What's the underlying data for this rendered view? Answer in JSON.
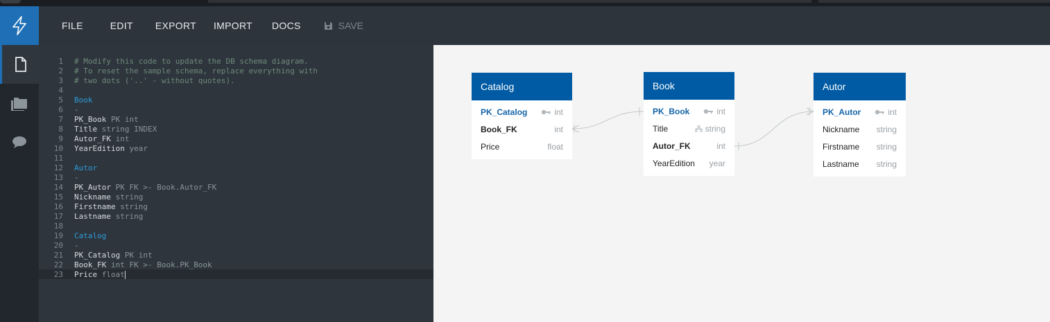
{
  "menu": {
    "file": "FILE",
    "edit": "EDIT",
    "export": "EXPORT",
    "import": "IMPORT",
    "docs": "DOCS",
    "save": "SAVE"
  },
  "sidebar": {
    "icons": [
      "bolt-logo-icon",
      "document-icon",
      "folder-icon",
      "comment-icon"
    ]
  },
  "editor": {
    "lines": [
      {
        "n": "1",
        "text": "# Modify this code to update the DB schema diagram."
      },
      {
        "n": "2",
        "text": "# To reset the sample schema, replace everything with"
      },
      {
        "n": "3",
        "text": "# two dots ('..' - without quotes)."
      },
      {
        "n": "4",
        "text": ""
      },
      {
        "n": "5",
        "text": "Book"
      },
      {
        "n": "6",
        "text": "-"
      },
      {
        "n": "7",
        "name": "PK_Book",
        "rest": " PK int"
      },
      {
        "n": "8",
        "name": "Title",
        "rest": " string INDEX"
      },
      {
        "n": "9",
        "name": "Autor_FK",
        "rest": " int"
      },
      {
        "n": "10",
        "name": "YearEdition",
        "rest": " year"
      },
      {
        "n": "11",
        "text": ""
      },
      {
        "n": "12",
        "text": "Autor"
      },
      {
        "n": "13",
        "text": "-"
      },
      {
        "n": "14",
        "name": "PK_Autor",
        "rest": " PK FK >- Book.Autor_FK"
      },
      {
        "n": "15",
        "name": "Nickname",
        "rest": " string"
      },
      {
        "n": "16",
        "name": "Firstname",
        "rest": " string"
      },
      {
        "n": "17",
        "name": "Lastname",
        "rest": " string"
      },
      {
        "n": "18",
        "text": ""
      },
      {
        "n": "19",
        "text": "Catalog"
      },
      {
        "n": "20",
        "text": "-"
      },
      {
        "n": "21",
        "name": "PK_Catalog",
        "rest": " PK int"
      },
      {
        "n": "22",
        "name": "Book_FK",
        "rest": " int FK >- Book.PK_Book"
      },
      {
        "n": "23",
        "name": "Price",
        "rest": " float"
      }
    ]
  },
  "tables": {
    "catalog": {
      "title": "Catalog",
      "fields": [
        {
          "name": "PK_Catalog",
          "type": "int"
        },
        {
          "name": "Book_FK",
          "type": "int"
        },
        {
          "name": "Price",
          "type": "float"
        }
      ]
    },
    "book": {
      "title": "Book",
      "fields": [
        {
          "name": "PK_Book",
          "type": "int"
        },
        {
          "name": "Title",
          "type": "string"
        },
        {
          "name": "Autor_FK",
          "type": "int"
        },
        {
          "name": "YearEdition",
          "type": "year"
        }
      ]
    },
    "autor": {
      "title": "Autor",
      "fields": [
        {
          "name": "PK_Autor",
          "type": "int"
        },
        {
          "name": "Nickname",
          "type": "string"
        },
        {
          "name": "Firstname",
          "type": "string"
        },
        {
          "name": "Lastname",
          "type": "string"
        }
      ]
    }
  },
  "colors": {
    "accent": "#1e6fb5",
    "table_header": "#005ba4",
    "pk_text": "#1565a8",
    "keyword": "#2d9bd6",
    "comment": "#6f8a79"
  }
}
